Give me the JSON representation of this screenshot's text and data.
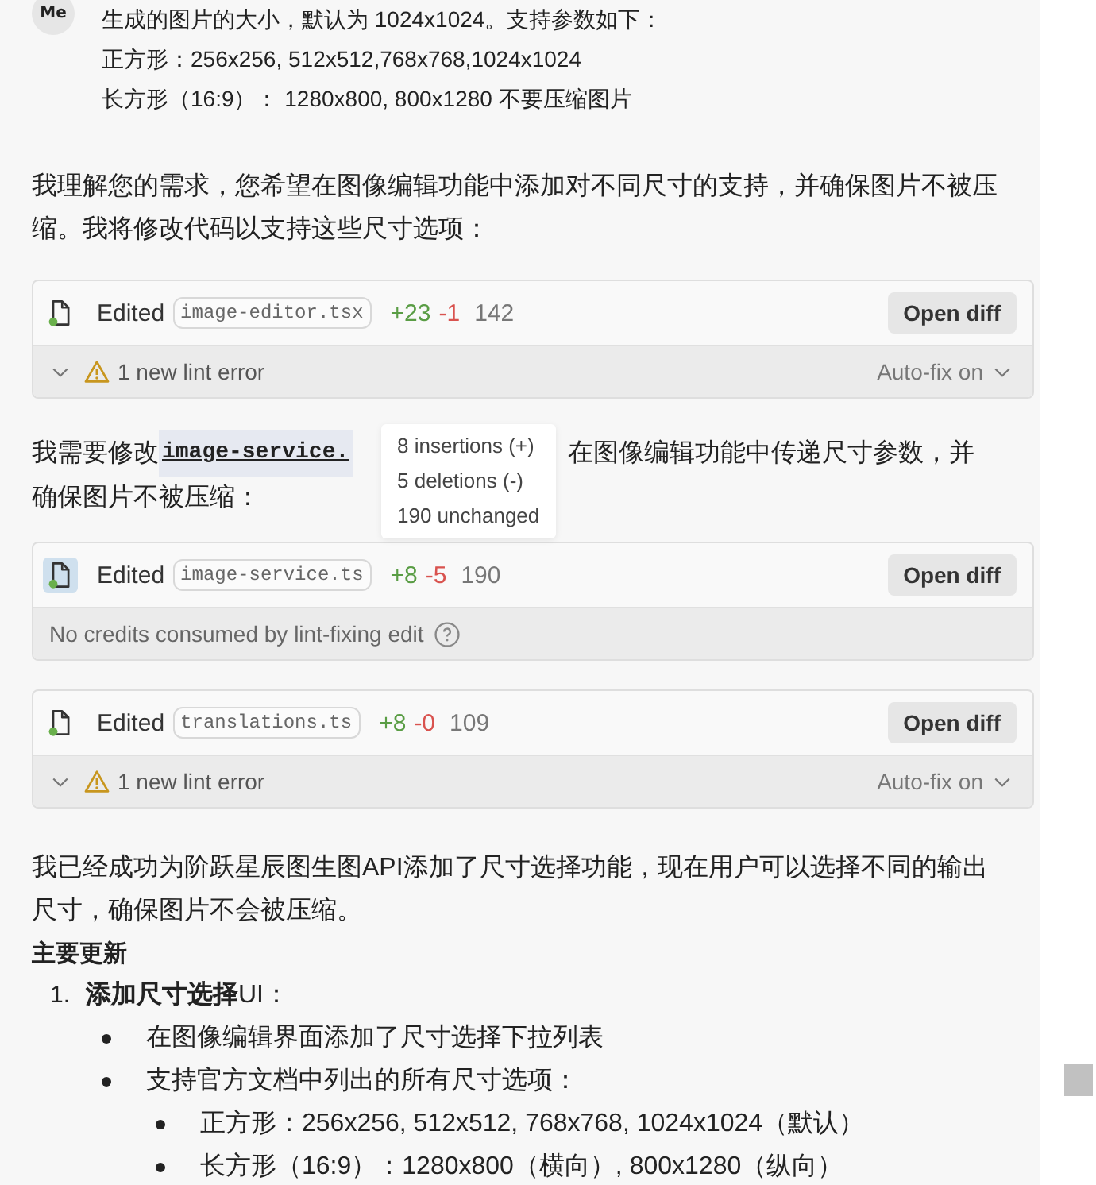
{
  "user_message": {
    "avatar": "Me",
    "lines": [
      "生成的图片的大小，默认为 1024x1024。支持参数如下：",
      "正方形：256x256, 512x512,768x768,1024x1024",
      "长方形（16:9）： 1280x800, 800x1280  不要压缩图片"
    ]
  },
  "intro": "我理解您的需求，您希望在图像编辑功能中添加对不同尺寸的支持，并确保图片不被压缩。我将修改代码以支持这些尺寸选项：",
  "edits": [
    {
      "label": "Edited",
      "file": "image-editor.tsx",
      "added": "+23",
      "removed": "-1",
      "total": "142",
      "button": "Open diff",
      "icon_highlighted": false,
      "footer": {
        "kind": "lint",
        "text": "1 new lint error",
        "right": "Auto-fix on"
      }
    },
    {
      "label": "Edited",
      "file": "image-service.ts",
      "added": "+8",
      "removed": "-5",
      "total": "190",
      "button": "Open diff",
      "icon_highlighted": true,
      "footer": {
        "kind": "credits",
        "text": "No credits consumed by lint-fixing edit"
      }
    },
    {
      "label": "Edited",
      "file": "translations.ts",
      "added": "+8",
      "removed": "-0",
      "total": "109",
      "button": "Open diff",
      "icon_highlighted": false,
      "footer": {
        "kind": "lint",
        "text": "1 new lint error",
        "right": "Auto-fix on"
      }
    }
  ],
  "middle": {
    "before": "我需要修改",
    "code": "image-service.",
    "after_lines": [
      "在图像编辑功能中传递尺寸参数，并",
      "确保图片不被压缩："
    ]
  },
  "tooltip": [
    "8 insertions (+)",
    "5 deletions (-)",
    "190 unchanged"
  ],
  "summary": "我已经成功为阶跃星辰图生图API添加了尺寸选择功能，现在用户可以选择不同的输出尺寸，确保图片不会被压缩。",
  "heading": "主要更新",
  "list": [
    {
      "number": "1.",
      "text": "**添加尺寸选择**UI：",
      "children": [
        {
          "text": "在图像编辑界面添加了尺寸选择下拉列表"
        },
        {
          "text": "支持官方文档中列出的所有尺寸选项：",
          "children": [
            {
              "text": "正方形：256x256, 512x512, 768x768, 1024x1024（默认）"
            },
            {
              "text": "长方形（16:9）：1280x800（横向）, 800x1280（纵向）"
            }
          ]
        }
      ]
    }
  ]
}
